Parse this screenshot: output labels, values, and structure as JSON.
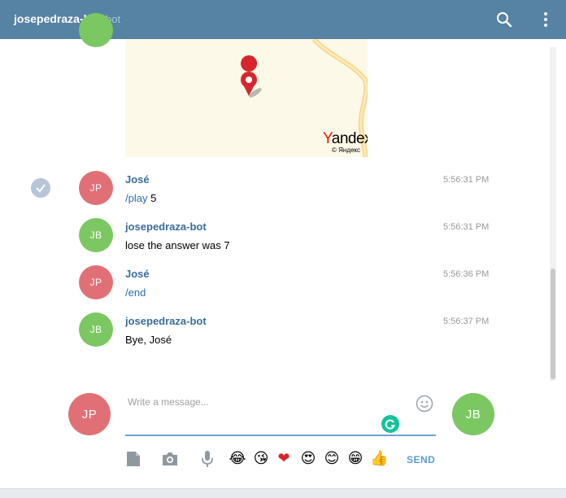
{
  "header": {
    "title": "josepedraza-bot",
    "subtitle": "bot",
    "icons": [
      "search-icon",
      "more-vertical-icon"
    ]
  },
  "map": {
    "brand_first": "Y",
    "brand_rest": "andex",
    "copyright": "© Яндекс"
  },
  "messages": [
    {
      "avatar": "JP",
      "author": "José",
      "time": "5:56:31 PM",
      "command": "/play",
      "text": " 5",
      "avatar_color": "#e17076"
    },
    {
      "avatar": "JB",
      "author": "josepedraza-bot",
      "time": "5:56:31 PM",
      "text": "lose the answer was 7",
      "avatar_color": "#7bc862"
    },
    {
      "avatar": "JP",
      "author": "José",
      "time": "5:56:36 PM",
      "command": "/end",
      "text": "",
      "avatar_color": "#e17076"
    },
    {
      "avatar": "JB",
      "author": "josepedraza-bot",
      "time": "5:56:37 PM",
      "text": "Bye, José",
      "avatar_color": "#7bc862"
    }
  ],
  "compose": {
    "placeholder": "Write a message...",
    "my_avatar": "JP",
    "peer_avatar": "JB",
    "send_label": "SEND",
    "emojis": [
      "😂",
      "😘",
      "❤",
      "😍",
      "😊",
      "😁",
      "👍"
    ]
  },
  "colors": {
    "header_bg": "#5682a3",
    "author": "#3a6d99",
    "command": "#2a6fb0",
    "send": "#5b9bd1"
  }
}
